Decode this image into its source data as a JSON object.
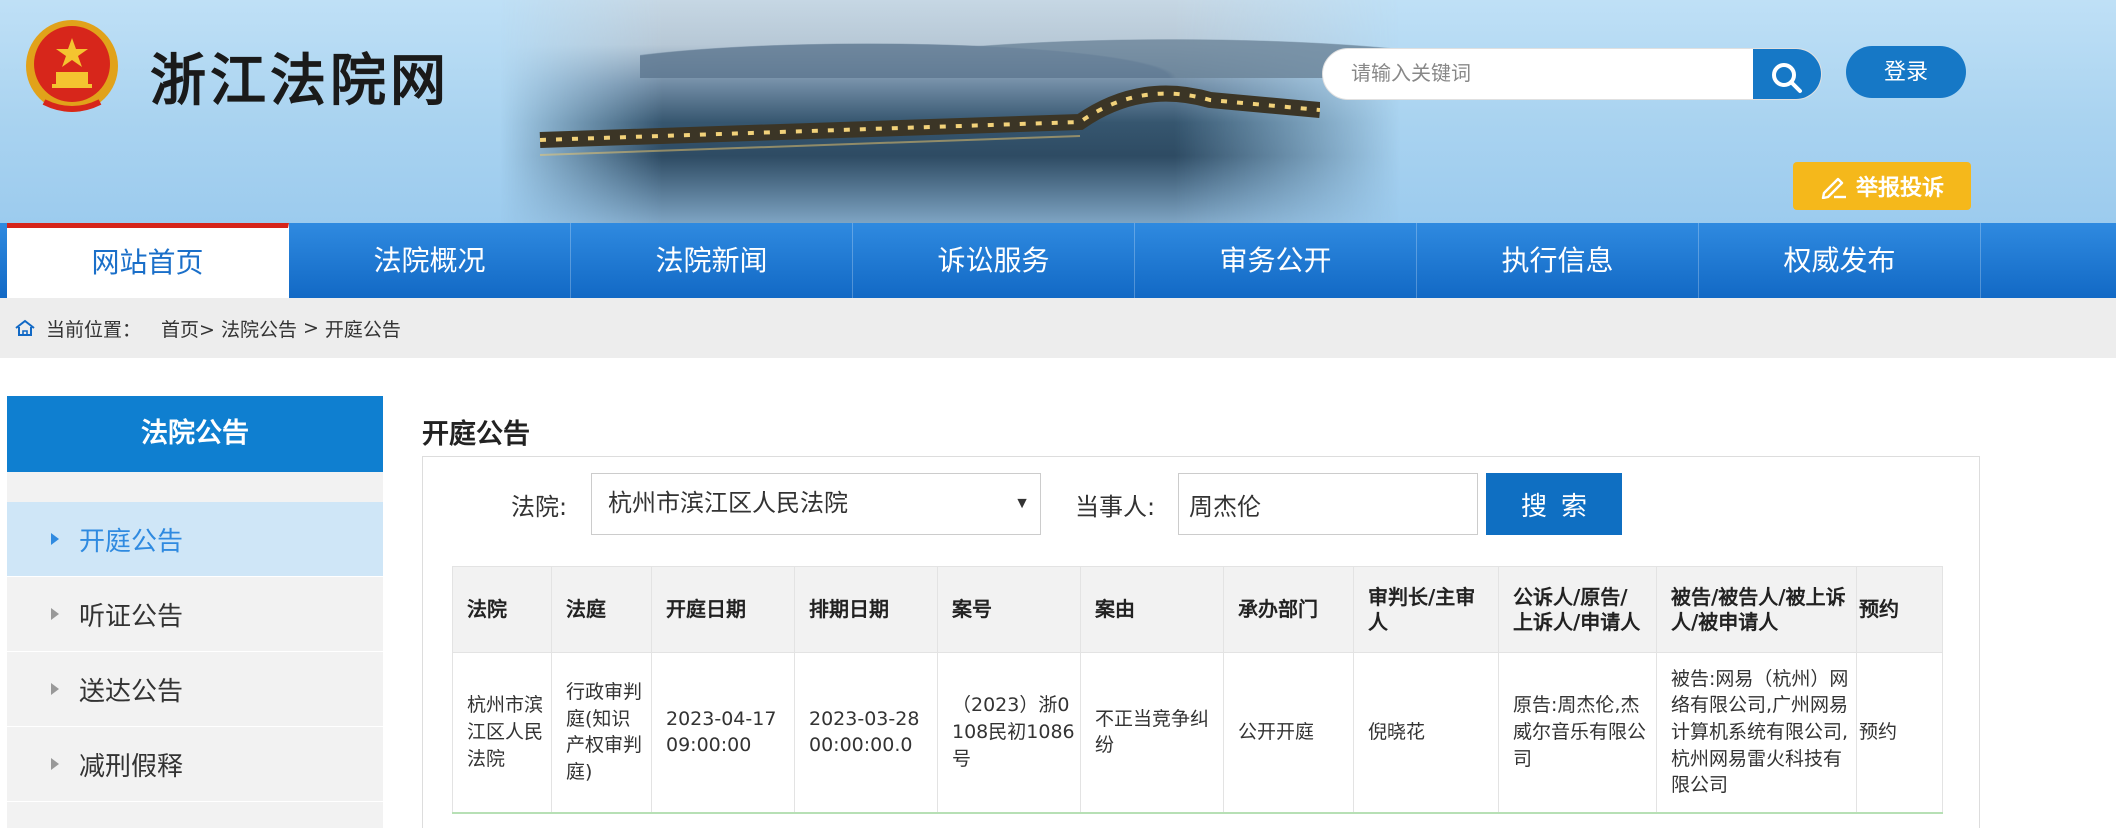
{
  "header": {
    "site_title": "浙江法院网",
    "search_placeholder": "请输入关键词",
    "login_label": "登录",
    "report_label": "举报投诉"
  },
  "nav": {
    "items": [
      {
        "label": "网站首页",
        "active": true
      },
      {
        "label": "法院概况"
      },
      {
        "label": "法院新闻"
      },
      {
        "label": "诉讼服务"
      },
      {
        "label": "审务公开"
      },
      {
        "label": "执行信息"
      },
      {
        "label": "权威发布"
      }
    ]
  },
  "breadcrumb": {
    "prefix": "当前位置：",
    "items": [
      "首页>",
      "法院公告",
      ">",
      "开庭公告"
    ]
  },
  "sidebar": {
    "title": "法院公告",
    "items": [
      {
        "label": "开庭公告",
        "active": true
      },
      {
        "label": "听证公告"
      },
      {
        "label": "送达公告"
      },
      {
        "label": "减刑假释"
      }
    ]
  },
  "main": {
    "title": "开庭公告",
    "filters": {
      "court_label": "法院:",
      "court_value": "杭州市滨江区人民法院",
      "party_label": "当事人:",
      "party_value": "周杰伦",
      "search_label": "搜索"
    },
    "table": {
      "headers": [
        "法院",
        "法庭",
        "开庭日期",
        "排期日期",
        "案号",
        "案由",
        "承办部门",
        "审判长/主审人",
        "公诉人/原告/上诉人/申请人",
        "被告/被告人/被上诉人/被申请人",
        "预约"
      ],
      "rows": [
        [
          "杭州市滨江区人民法院",
          "行政审判庭(知识产权审判庭)",
          "2023-04-17 09:00:00",
          "2023-03-28 00:00:00.0",
          "（2023）浙0108民初1086号",
          "不正当竞争纠纷",
          "公开开庭",
          "倪晓花",
          "原告:周杰伦,杰威尔音乐有限公司",
          "被告:网易（杭州）网络有限公司,广州网易计算机系统有限公司,杭州网易雷火科技有限公司",
          "预约"
        ]
      ]
    }
  },
  "icons": {
    "emblem": "national-emblem-icon",
    "search": "search-icon",
    "report": "pen-icon",
    "home": "home-icon"
  },
  "colors": {
    "nav_blue": "#1269c5",
    "accent_red": "#d6241a",
    "report_yellow": "#f5b81b",
    "sidebar_blue": "#0f7fd0"
  }
}
